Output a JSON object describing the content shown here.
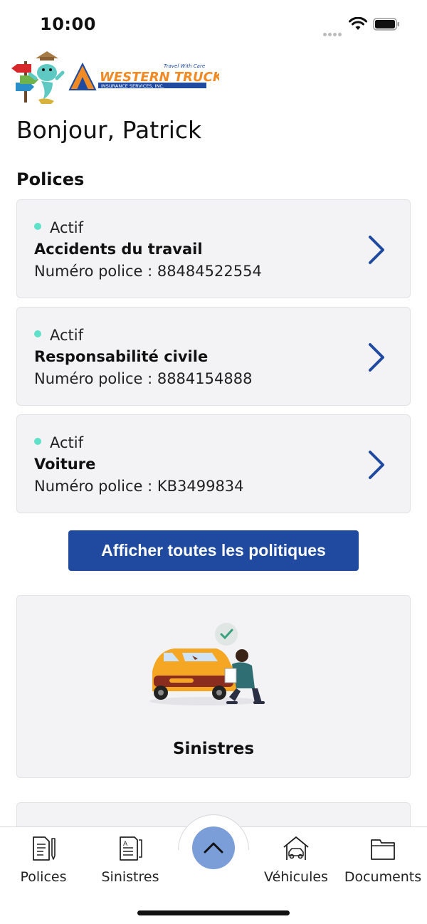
{
  "status_bar": {
    "time": "10:00"
  },
  "header": {
    "brand_name": "WESTERN TRUCK",
    "brand_tagline": "Travel With Care",
    "brand_subtitle": "INSURANCE SERVICES, INC."
  },
  "greeting": "Bonjour, Patrick",
  "policies_section": {
    "title": "Polices",
    "items": [
      {
        "status": "Actif",
        "name": "Accidents du travail",
        "number": "Numéro police : 88484522554"
      },
      {
        "status": "Actif",
        "name": "Responsabilité civile",
        "number": "Numéro police : 8884154888"
      },
      {
        "status": "Actif",
        "name": "Voiture",
        "number": "Numéro police : KB3499834"
      }
    ],
    "view_all_label": "Afficher toutes les politiques"
  },
  "claims_card": {
    "label": "Sinistres"
  },
  "bottom_nav": {
    "items": [
      {
        "label": "Polices",
        "icon": "policy-document-icon"
      },
      {
        "label": "Sinistres",
        "icon": "claims-document-icon"
      },
      {
        "label": "Véhicules",
        "icon": "vehicle-garage-icon"
      },
      {
        "label": "Documents",
        "icon": "folder-icon"
      }
    ],
    "center_action_icon": "chevron-up-icon"
  },
  "colors": {
    "accent": "#1f4aa0",
    "active_dot": "#5fe0c8",
    "card_bg": "#f3f3f6",
    "fab": "#7b9ed8"
  }
}
